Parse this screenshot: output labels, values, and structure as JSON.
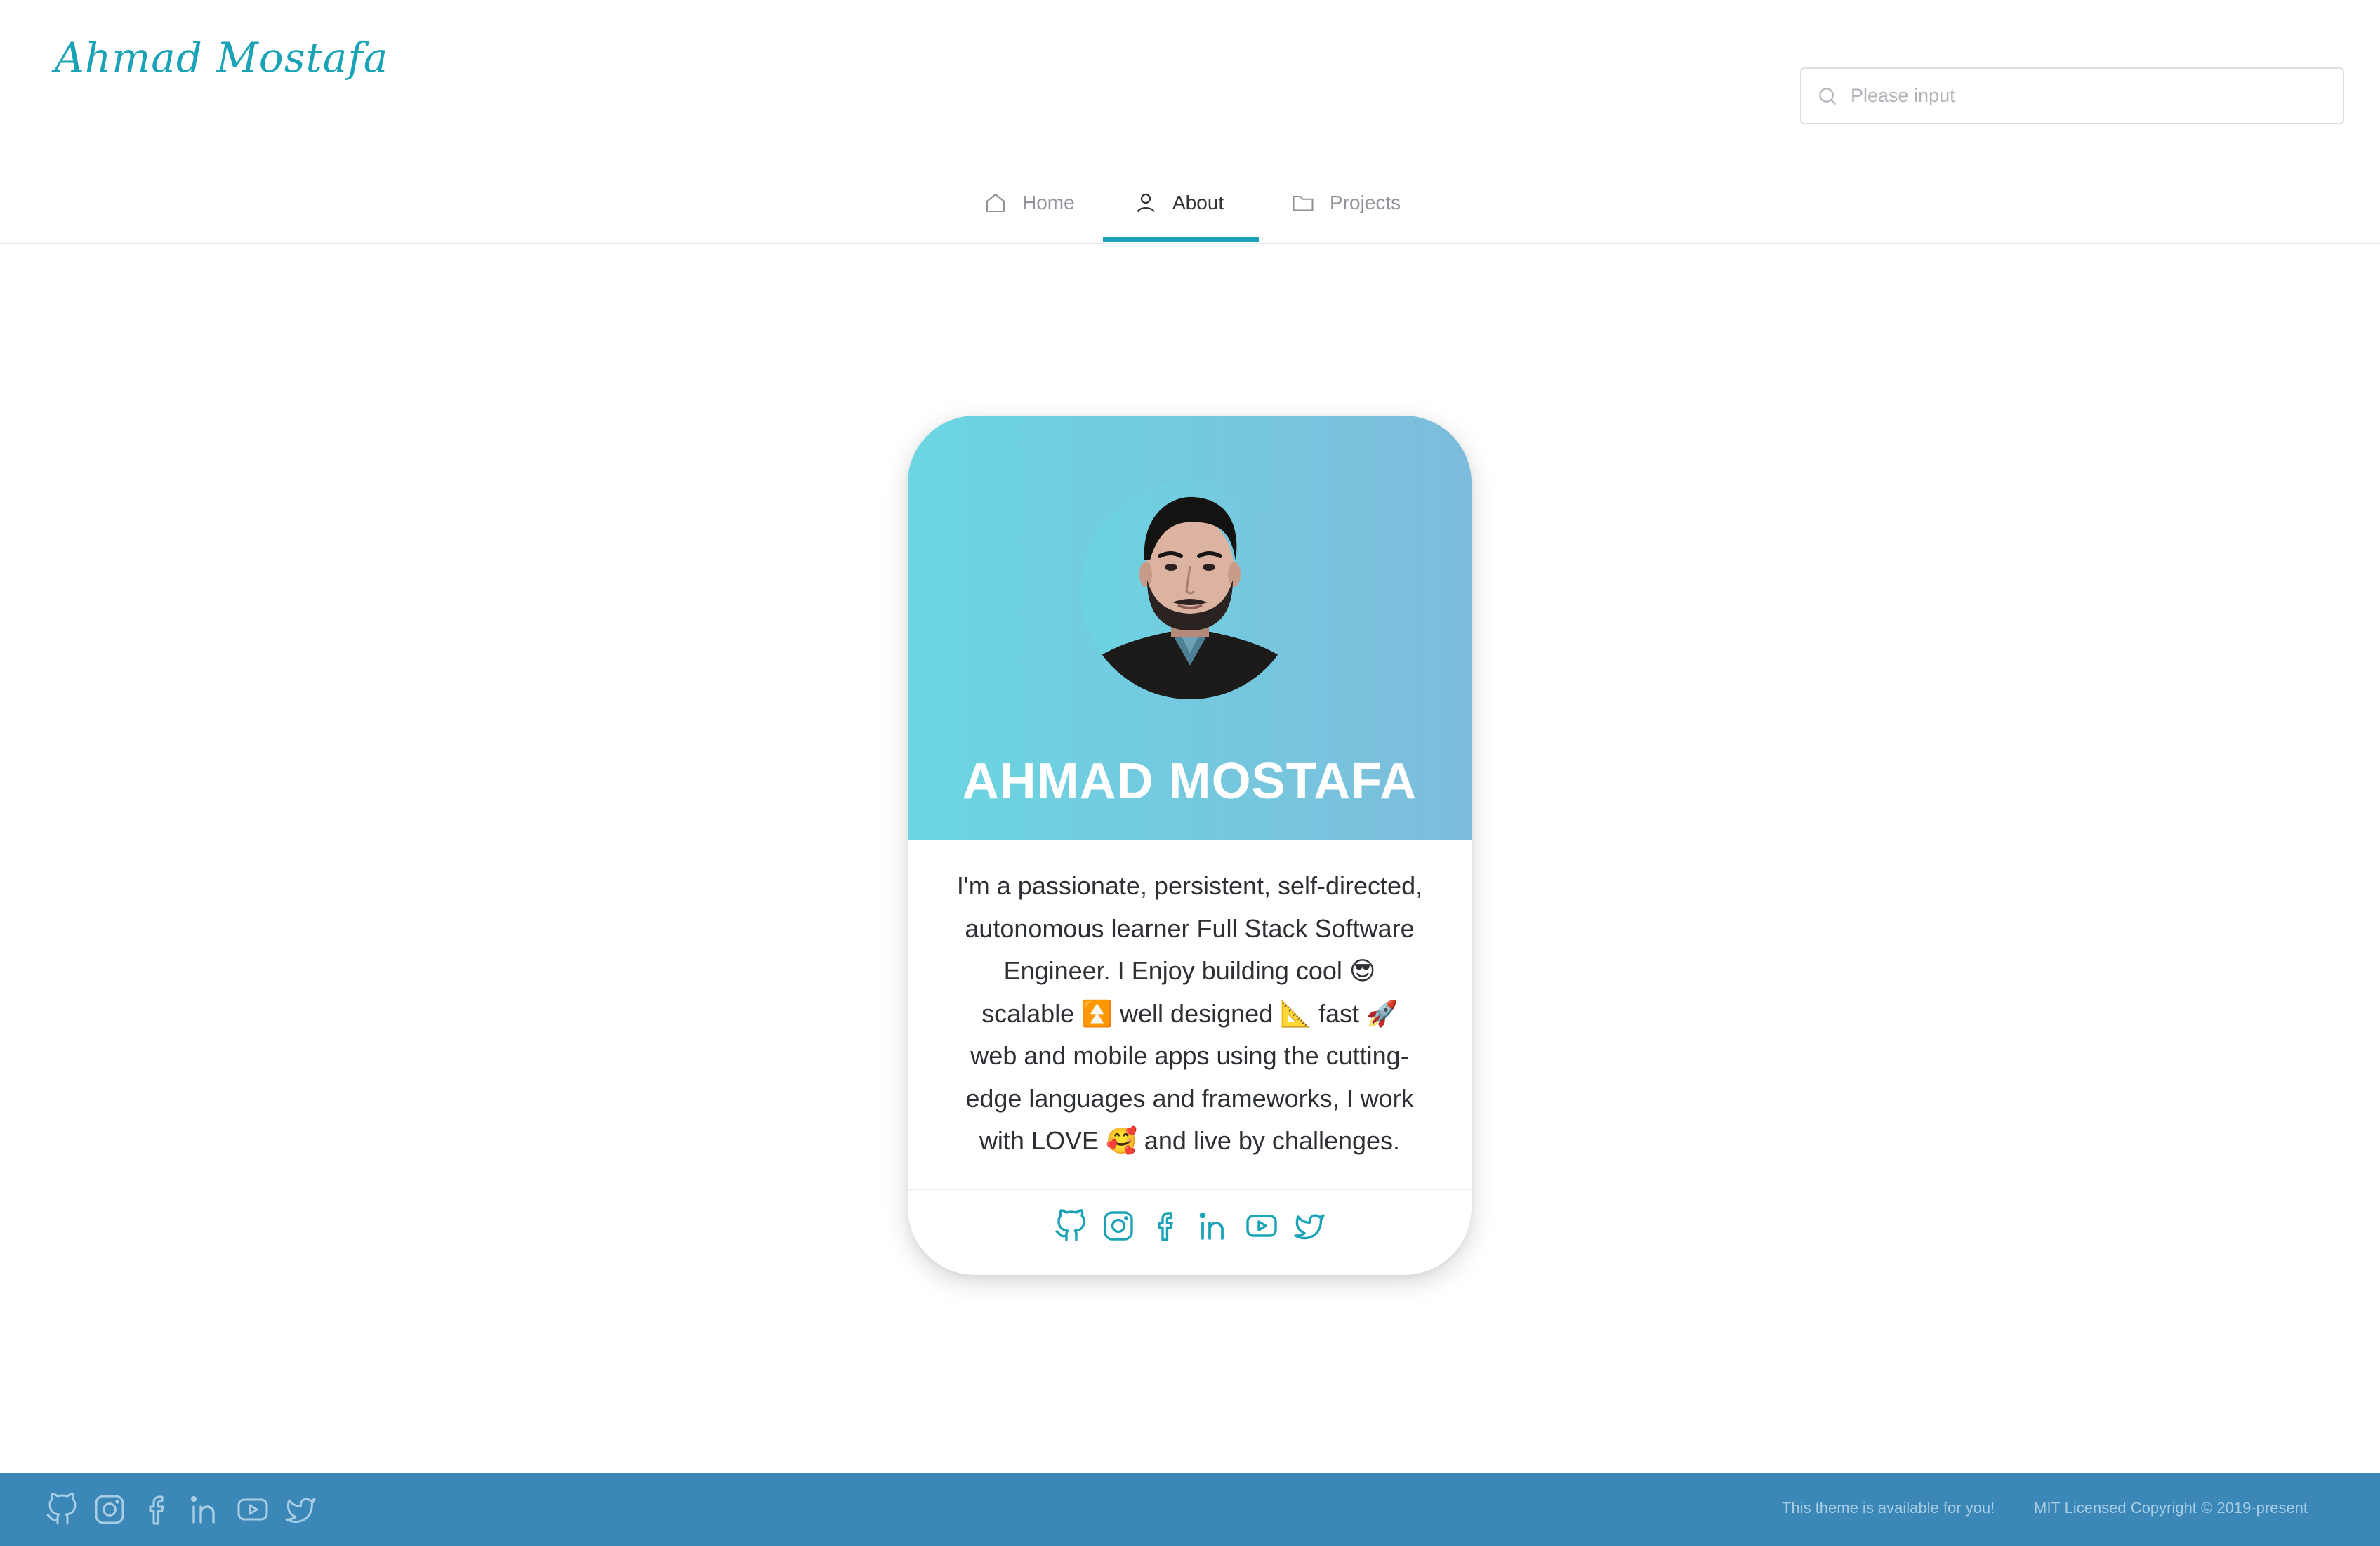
{
  "header": {
    "brand": "Ahmad Mostafa",
    "search": {
      "placeholder": "Please input",
      "icon": "search-icon"
    }
  },
  "nav": {
    "tabs": [
      {
        "label": "Home",
        "icon": "home-icon",
        "active": false
      },
      {
        "label": "About",
        "icon": "user-icon",
        "active": true
      },
      {
        "label": "Projects",
        "icon": "folder-icon",
        "active": false
      }
    ],
    "accent": "#1aa3b6"
  },
  "card": {
    "name": "AHMAD MOSTAFA",
    "bio_lines": [
      "I'm a passionate, persistent, self-directed,",
      "autonomous learner Full Stack Software",
      "Engineer. I Enjoy building cool 😎",
      "scalable ⏫  well designed 📐  fast 🚀",
      "web and mobile apps using the cutting-",
      "edge languages and frameworks, I work",
      "with LOVE 🥰  and live by challenges."
    ],
    "gradient": [
      "#6bd6e2",
      "#7dbcdb"
    ],
    "social": [
      "github-icon",
      "instagram-icon",
      "facebook-icon",
      "linkedin-icon",
      "youtube-icon",
      "twitter-icon"
    ]
  },
  "footer": {
    "social": [
      "github-icon",
      "instagram-icon",
      "facebook-icon",
      "linkedin-icon",
      "youtube-icon",
      "twitter-icon"
    ],
    "theme_text": "This theme is available for you!",
    "license_text": "MIT Licensed Copyright © 2019-present",
    "background": "#3a87b8"
  }
}
